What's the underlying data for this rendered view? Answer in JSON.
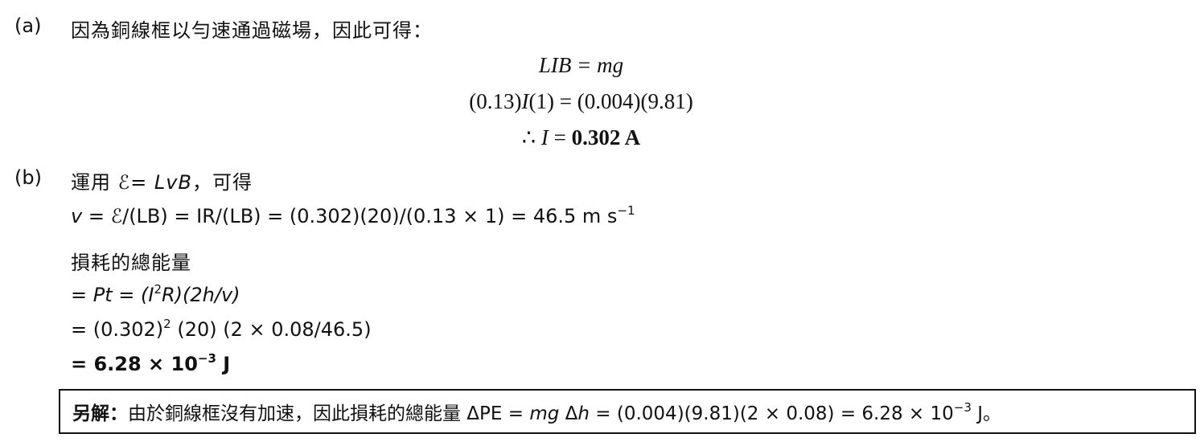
{
  "part_a": {
    "label": "(a)",
    "intro": "因為銅線框以勻速通過磁場，因此可得：",
    "equations": {
      "line1": "LIB = mg",
      "line2_left": "(0.13)",
      "line2_var": "I",
      "line2_right": "(1) = (0.004)(9.81)",
      "line3_prefix": "∴",
      "line3_var": "I",
      "line3_eq": "=",
      "line3_result": "0.302 A"
    }
  },
  "part_b": {
    "label": "(b)",
    "intro_prefix": "運用",
    "intro_formula": "ℰ= LvB",
    "intro_suffix": "，可得",
    "velocity_var": "v",
    "velocity_line": " = ℰ/(LB) = IR/(LB) = (0.302)(20)/(0.13 × 1) = 46.5 m s",
    "velocity_unit_exp": "−1",
    "energy_heading": "損耗的總能量",
    "step1_prefix": "= ",
    "step1_formula": "Pt = (I",
    "step1_exp": "2",
    "step1_rest": "R)(2h/v)",
    "step2_prefix": "= (0.302)",
    "step2_exp": "2",
    "step2_rest": " (20) (2 × 0.08/46.5)",
    "step3_prefix": "= 6.28 × 10",
    "step3_exp": "−3",
    "step3_unit": " J"
  },
  "alt_solution": {
    "label": "另解：",
    "text_before": "由於銅線框沒有加速，因此損耗的總能量 ΔPE = ",
    "text_mg": "mg",
    "text_delta": " Δ",
    "text_h": "h",
    "text_after": " = (0.004)(9.81)(2 × 0.08) = 6.28 × 10",
    "text_exp": "−3",
    "text_end": " J。"
  }
}
